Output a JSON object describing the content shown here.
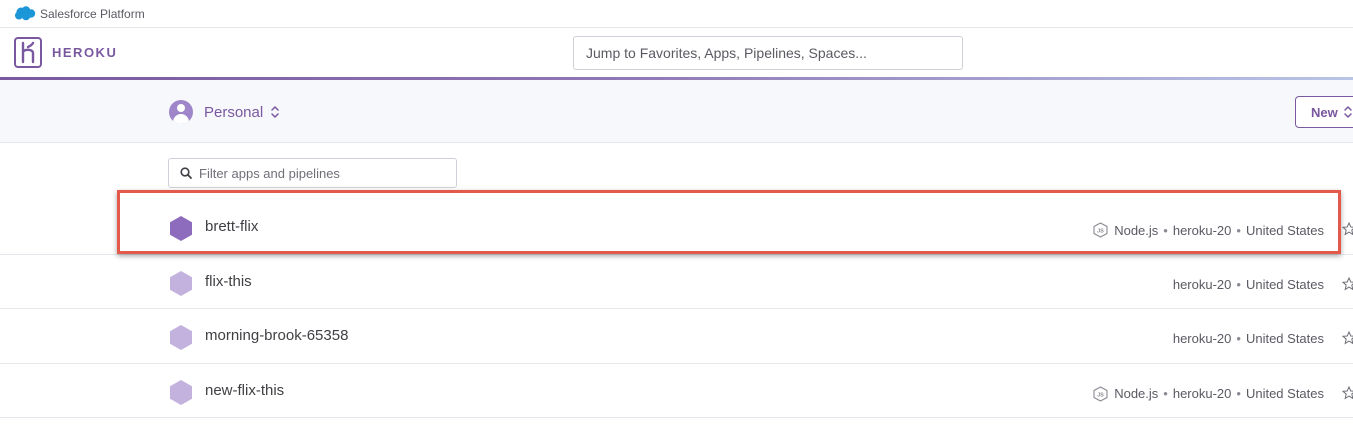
{
  "platform_bar": {
    "text": "Salesforce Platform"
  },
  "header": {
    "logo_text": "HEROKU",
    "search_placeholder": "Jump to Favorites, Apps, Pipelines, Spaces..."
  },
  "team_bar": {
    "team_name": "Personal",
    "new_button_label": "New"
  },
  "filter": {
    "placeholder": "Filter apps and pipelines"
  },
  "apps": [
    {
      "name": "brett-flix",
      "buildpack": "Node.js",
      "stack": "heroku-20",
      "region": "United States",
      "highlighted": true
    },
    {
      "name": "flix-this",
      "buildpack": "",
      "stack": "heroku-20",
      "region": "United States",
      "highlighted": false
    },
    {
      "name": "morning-brook-65358",
      "buildpack": "",
      "stack": "heroku-20",
      "region": "United States",
      "highlighted": false
    },
    {
      "name": "new-flix-this",
      "buildpack": "Node.js",
      "stack": "heroku-20",
      "region": "United States",
      "highlighted": false
    }
  ],
  "separator": "•",
  "colors": {
    "brand": "#79589f",
    "hex_active": "#8d6cbd",
    "hex_inactive": "#c3b1de",
    "highlight": "#e35a4a",
    "salesforce_blue": "#1b96d6"
  },
  "icons": {
    "platform": "salesforce-cloud-icon",
    "logo": "heroku-logo-icon",
    "team": "user-avatar-icon",
    "switch": "up-down-chevron-icon",
    "filter": "search-icon",
    "app": "hexagon-app-icon",
    "buildpack": "nodejs-icon",
    "favorite": "star-icon"
  }
}
